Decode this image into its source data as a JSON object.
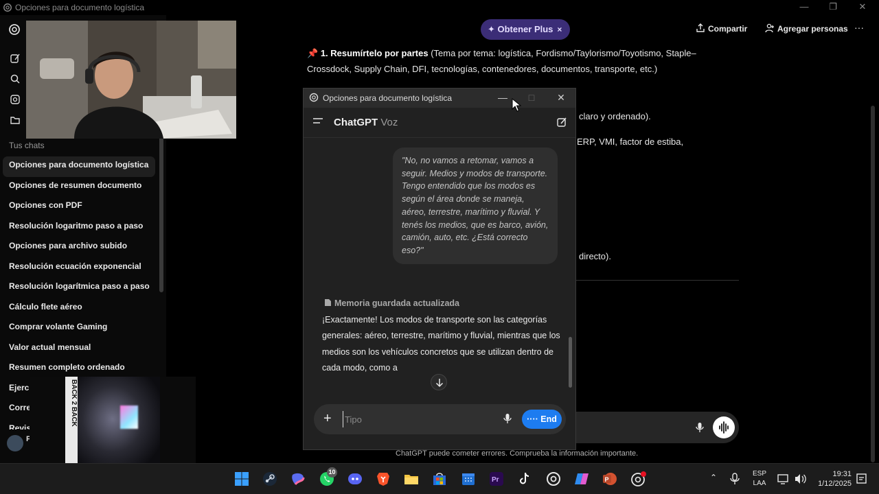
{
  "window": {
    "title": "Opciones para documento logística",
    "minimize": "—",
    "restore": "❐",
    "close": "✕"
  },
  "sidebar": {
    "section_title": "Tus chats",
    "chats": [
      {
        "label": "Opciones para documento logística",
        "active": true
      },
      {
        "label": "Opciones de resumen documento"
      },
      {
        "label": "Opciones con PDF"
      },
      {
        "label": "Resolución logaritmo paso a paso"
      },
      {
        "label": "Opciones para archivo subido"
      },
      {
        "label": "Resolución ecuación exponencial"
      },
      {
        "label": "Resolución logarítmica paso a paso"
      },
      {
        "label": "Cálculo flete aéreo"
      },
      {
        "label": "Comprar volante Gaming"
      },
      {
        "label": "Valor actual mensual"
      },
      {
        "label": "Resumen completo ordenado"
      },
      {
        "label": "Ejercic"
      },
      {
        "label": "Corre"
      },
      {
        "label": "Revisi"
      }
    ],
    "user_initial": "P"
  },
  "header": {
    "upgrade_label": "✦ Obtener Plus",
    "upgrade_close": "×",
    "share_label": "Compartir",
    "add_people_label": "Agregar personas",
    "more_label": "···"
  },
  "main": {
    "pin": "📌",
    "summary_bold": "1. Resumírtelo por partes",
    "summary_rest": " (Tema por tema: logística, Fordismo/Taylorismo/Toyotismo, Staple–Crossdock, Supply Chain, DFI, tecnologías, contenedores, documentos, transporte, etc.)",
    "behind_1": "claro y ordenado).",
    "behind_2": "ERP, VMI, factor de estiba,",
    "behind_3": "directo).",
    "disclaimer": "ChatGPT puede cometer errores. Comprueba la información importante."
  },
  "float": {
    "title": "Opciones para documento logística",
    "app_title": "ChatGPT",
    "app_subtitle": "Voz",
    "user_message": "\"No, no vamos a retomar, vamos a seguir. Medios y modos de transporte. Tengo entendido que los modos es según el área donde se maneja, aéreo, terrestre, marítimo y fluvial. Y tenés los medios, que es barco, avión, camión, auto, etc. ¿Está correcto eso?\"",
    "memory_note": "Memoria guardada actualizada",
    "assistant_message": "¡Exactamente! Los modos de transporte son las categorías generales: aéreo, terrestre, marítimo y fluvial, mientras que los medios son los vehículos concretos que se utilizan dentro de cada modo, como a",
    "input_placeholder": "Tipo",
    "plus_label": "+",
    "end_label": "···· End"
  },
  "overlay": {
    "video_banner": "BACK 2 BACK"
  },
  "taskbar": {
    "whatsapp_badge": "10",
    "lang_line1": "ESP",
    "lang_line2": "LAA",
    "time": "19:31",
    "date": "1/12/2025"
  },
  "colors": {
    "accent_blue": "#1d7cf0",
    "plus_purple": "#3b2d77",
    "bubble": "#2f2f2f"
  }
}
